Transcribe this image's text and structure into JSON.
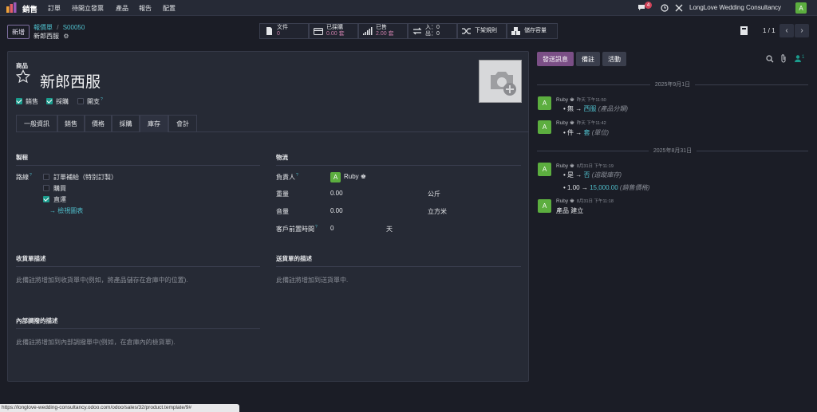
{
  "app": {
    "name": "銷售",
    "menu": [
      "訂單",
      "待開立發票",
      "產品",
      "報告",
      "配置"
    ]
  },
  "topbar_right": {
    "chat_badge": "4",
    "company": "LongLove Wedding Consultancy",
    "avatar_letter": "A"
  },
  "control": {
    "new_label": "新增",
    "breadcrumb_parent": "報價單",
    "breadcrumb_sep": "/",
    "breadcrumb_order": "S00050",
    "record_name": "新郎西服",
    "stat_buttons": [
      {
        "label": "文件",
        "value": "0"
      },
      {
        "label": "已採購",
        "value": "0.00 套"
      },
      {
        "label": "已售",
        "value": "2.00 套"
      },
      {
        "label": "入：0",
        "value": "出：0"
      },
      {
        "label": "下架規則",
        "value": ""
      },
      {
        "label": "儲存容量",
        "value": ""
      }
    ],
    "pager": "1 / 1"
  },
  "form": {
    "product_label": "商品",
    "product_name": "新郎西服",
    "checkboxes": [
      {
        "label": "銷售",
        "checked": true
      },
      {
        "label": "採購",
        "checked": true
      },
      {
        "label": "開支",
        "checked": false
      }
    ],
    "tabs": [
      "一般資訊",
      "銷售",
      "價格",
      "採購",
      "庫存",
      "會計"
    ],
    "active_tab": "庫存",
    "operations": {
      "title": "製程",
      "routes_label": "路線",
      "routes": [
        {
          "label": "訂單補給（特別訂製）",
          "checked": false
        },
        {
          "label": "購買",
          "checked": false
        },
        {
          "label": "直運",
          "checked": true
        }
      ],
      "view_diagram": "檢視圖表"
    },
    "logistics": {
      "title": "物流",
      "responsible_label": "負責人",
      "responsible_name": "Ruby",
      "weight_label": "重量",
      "weight_value": "0.00",
      "weight_unit": "公斤",
      "volume_label": "音量",
      "volume_value": "0.00",
      "volume_unit": "立方米",
      "lead_label": "客戶前置時間",
      "lead_value": "0",
      "lead_unit": "天"
    },
    "receipt": {
      "title": "收貨單描述",
      "placeholder": "此備註將增加到收貨單中(例如，將產品儲存在倉庫中的位置)."
    },
    "delivery": {
      "title": "送貨單的描述",
      "placeholder": "此備註將增加到送貨單中."
    },
    "internal": {
      "title": "內部調撥的描述",
      "placeholder": "此備註將增加到內部調撥單中(例如，在倉庫內的檢貨單)."
    }
  },
  "chatter": {
    "send_message": "發送訊息",
    "note": "備註",
    "activity": "活動",
    "follower_count": "1",
    "date1": "2025年9月1日",
    "date2": "2025年8月31日",
    "messages": [
      {
        "author": "Ruby",
        "time": "昨天 下午11:50",
        "old": "無",
        "arrow": "→",
        "new": "西服",
        "field": "(產品分類)"
      },
      {
        "author": "Ruby",
        "time": "昨天 下午11:42",
        "old": "件",
        "arrow": "→",
        "new": "套",
        "field": "(單位)"
      },
      {
        "author": "Ruby",
        "time": "8月31日 下午11:19",
        "old": "是",
        "arrow": "→",
        "new": "否",
        "field": "(追蹤庫存)",
        "old2": "1.00",
        "new2": "15,000.00",
        "field2": "(銷售價格)"
      },
      {
        "author": "Ruby",
        "time": "8月31日 下午11:18",
        "body": "產品 建立"
      }
    ]
  },
  "status_url": "https://longlove-wedding-consultancy.odoo.com/odoo/sales/32/product.template/9#",
  "colors": {
    "accent": "#7b4f86",
    "link": "#4fbecb",
    "avatar": "#5cae3f",
    "checkbox": "#1b9c8d"
  }
}
